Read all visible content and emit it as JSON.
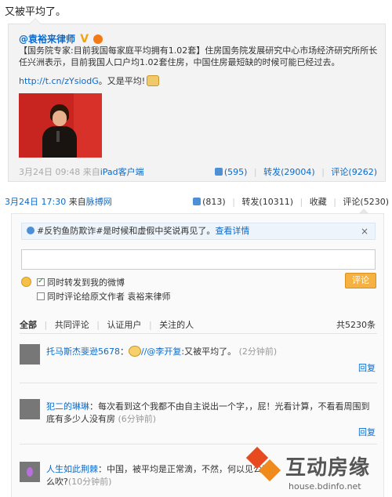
{
  "post": {
    "text": "又被平均了。",
    "meta_time": "3月24日 17:30",
    "meta_from": "来自",
    "meta_source": "脉搏网",
    "actions": {
      "like_count": "(813)",
      "repost": "转发(10311)",
      "favorite": "收藏",
      "comment": "评论(5230)"
    }
  },
  "original": {
    "author": "@袁裕来律师",
    "vip_badge": "V",
    "text": "【国务院专家:目前我国每家庭平均拥有1.02套】住房国务院发展研究中心市场经济研究所所长任兴洲表示，目前我国人口户均1.02套住房，中国住房最短缺的时候可能已经过去。",
    "link": "http://t.cn/zYsiodG",
    "link_suffix": "。又是平均!",
    "time": "3月24日 09:48",
    "from": "来自",
    "source": "iPad客户端",
    "like_count": "(595)",
    "repost": "转发(29004)",
    "comment": "评论(9262)"
  },
  "comment_box": {
    "notice_text": "#反钓鱼防欺诈#是时候和虚假中奖说再见了。",
    "notice_link": "查看详情",
    "notice_close": "×",
    "input_value": "",
    "option_repost": "同时转发到我的微博",
    "option_comment_original": "同时评论给原文作者 袁裕来律师",
    "submit_label": "评论"
  },
  "filters": {
    "all": "全部",
    "mutual": "共同评论",
    "verified": "认证用户",
    "following": "关注的人",
    "total": "共5230条"
  },
  "comments": [
    {
      "user": "托马斯杰斐逊5678",
      "colon": "：",
      "mention": "//@李开复",
      "text": ":又被平均了。",
      "time": "(2分钟前)",
      "reply": "回复"
    },
    {
      "user": "犯二的琳琳",
      "colon": "：",
      "text": "每次看到这个我都不由自主说出一个字，，屁！光看计算，不看看周围到底有多少人没有房",
      "time": "(6分钟前)",
      "reply": "回复"
    },
    {
      "user": "人生如此荆棘",
      "colon": "：",
      "text": "中国，被平均是正常滴，不然，何以见公平",
      "text2": "么吹?",
      "time": "(10分钟前)"
    }
  ],
  "watermark": {
    "title": "互动房缘",
    "url": "house.bdinfo.net"
  }
}
